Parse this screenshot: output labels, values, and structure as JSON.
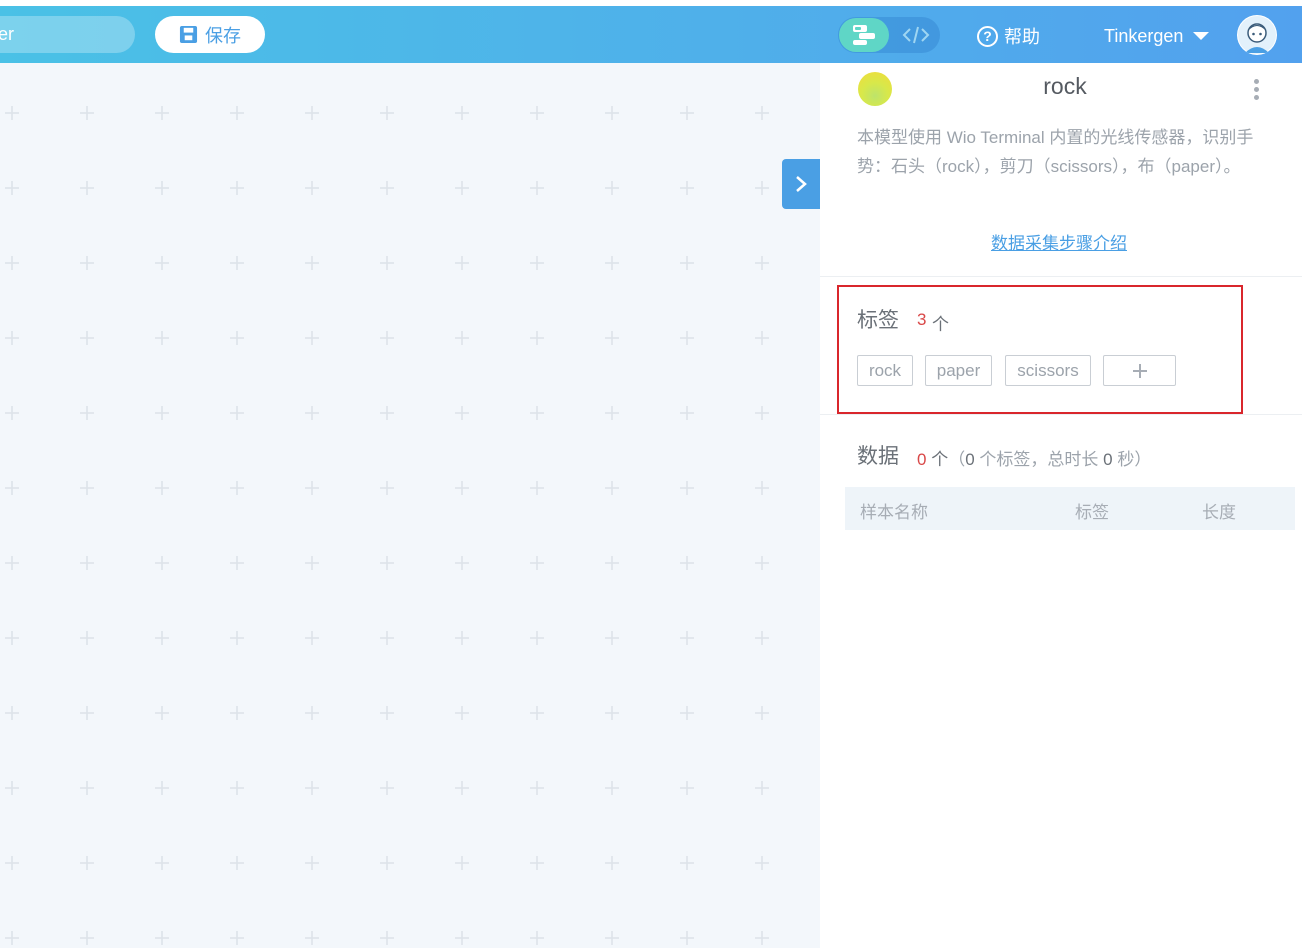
{
  "topbar": {
    "project_name": "er",
    "save_label": "保存",
    "help_label": "帮助",
    "user_name": "Tinkergen",
    "colors": {
      "gradient_start": "#4ac1e6",
      "gradient_end": "#52a1ee",
      "mode_active": "#5fd6c6"
    },
    "icons": [
      "save-icon",
      "blocks-mode-icon",
      "code-mode-icon",
      "help-icon",
      "caret-down-icon",
      "avatar-icon"
    ]
  },
  "panel": {
    "model_name": "rock",
    "description": "本模型使用 Wio Terminal 内置的光线传感器，识别手势：石头（rock），剪刀（scissors），布（paper）。",
    "guide_link": "数据采集步骤介绍",
    "labels": {
      "title": "标签",
      "count": "3",
      "unit": "个",
      "items": [
        "rock",
        "paper",
        "scissors"
      ]
    },
    "data": {
      "title": "数据",
      "count": "0",
      "unit": "个",
      "open_paren": "（",
      "label_count": "0",
      "label_text": "个标签，总时长",
      "duration": "0",
      "duration_unit": "秒",
      "close_paren": "）",
      "columns": [
        "样本名称",
        "标签",
        "长度"
      ]
    },
    "colors": {
      "accent": "#4a9fe4",
      "count_red": "#d94848",
      "highlight_border": "#d9262c"
    }
  }
}
